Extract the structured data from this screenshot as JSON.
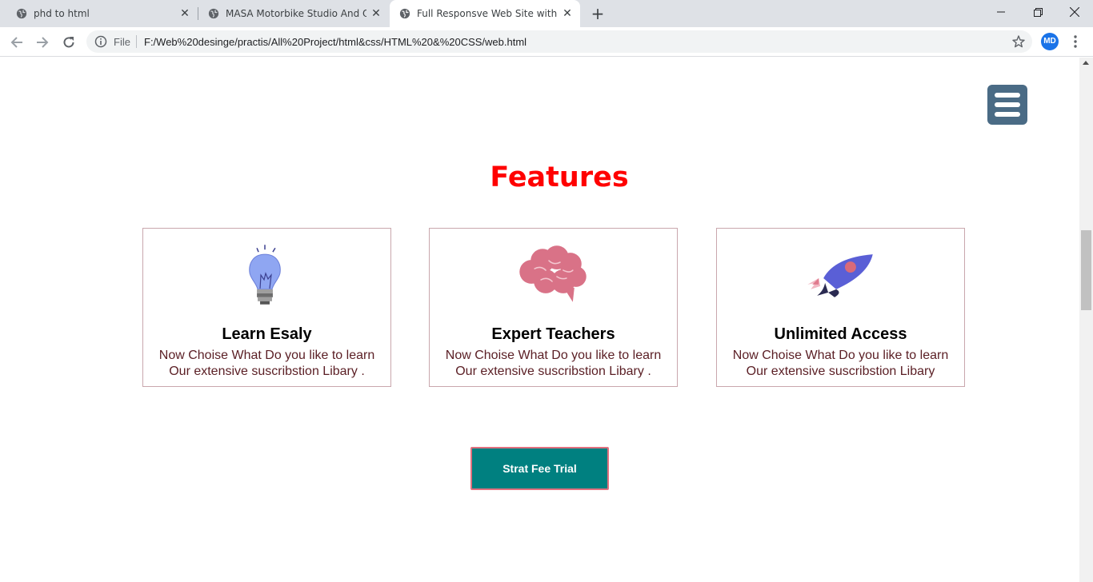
{
  "browser": {
    "tabs": [
      {
        "title": "phd to html",
        "icon": "globe-icon",
        "active": false
      },
      {
        "title": "MASA Motorbike Studio And Onl",
        "icon": "globe-icon",
        "active": false
      },
      {
        "title": "Full Responsve Web Site with htr",
        "icon": "globe-icon",
        "active": true
      }
    ],
    "address": {
      "scheme_label": "File",
      "url": "F:/Web%20desinge/practis/All%20Project/html&css/HTML%20&%20CSS/web.html"
    },
    "profile_initials": "MD",
    "colors": {
      "tabstrip": "#dee1e6",
      "avatar": "#1a73e8"
    }
  },
  "page": {
    "menu_icon": "hamburger-menu-icon",
    "section_title": "Features",
    "cards": [
      {
        "icon": "lightbulb-icon",
        "title": "Learn Esaly",
        "text": "Now Choise What Do you like to learn Our extensive suscribstion Libary ."
      },
      {
        "icon": "brain-icon",
        "title": "Expert Teachers",
        "text": "Now Choise What Do you like to learn Our extensive suscribstion Libary ."
      },
      {
        "icon": "rocket-icon",
        "title": "Unlimited Access",
        "text": "Now Choise What Do you like to learn Our extensive suscribstion Libary"
      }
    ],
    "cta_label": "Strat Fee Trial",
    "colors": {
      "title": "#ff0000",
      "button": "#008080",
      "button_border": "#e0707e",
      "menu": "#4a6b85"
    }
  }
}
